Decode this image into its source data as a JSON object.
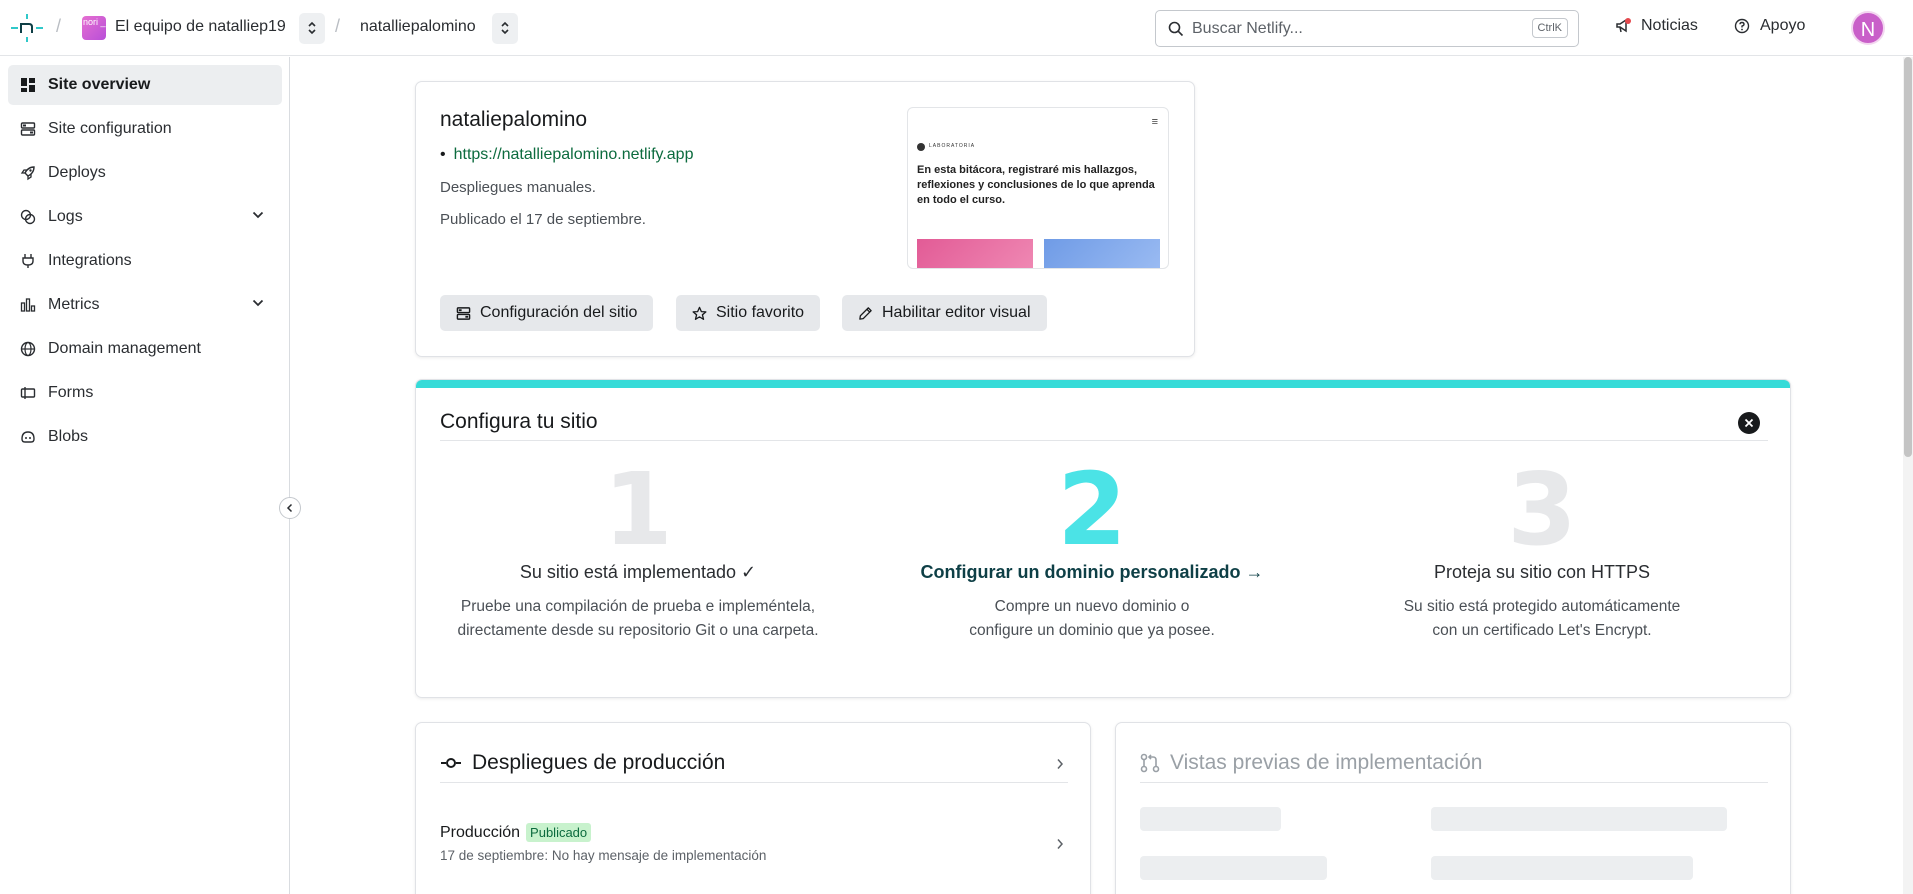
{
  "topbar": {
    "team_avatar_text": "nori\n_",
    "team_name": "El equipo de natalliep19",
    "site_name": "natalliepalomino",
    "search_placeholder": "Buscar Netlify...",
    "search_shortcut": "CtrlK",
    "news_label": "Noticias",
    "help_label": "Apoyo",
    "user_initial": "N"
  },
  "sidebar": {
    "items": [
      {
        "label": "Site overview",
        "icon": "grid-icon"
      },
      {
        "label": "Site configuration",
        "icon": "sliders-icon"
      },
      {
        "label": "Deploys",
        "icon": "rocket-icon"
      },
      {
        "label": "Logs",
        "icon": "logs-icon"
      },
      {
        "label": "Integrations",
        "icon": "plug-icon"
      },
      {
        "label": "Metrics",
        "icon": "bar-chart-icon"
      },
      {
        "label": "Domain management",
        "icon": "globe-icon"
      },
      {
        "label": "Forms",
        "icon": "form-icon"
      },
      {
        "label": "Blobs",
        "icon": "blob-icon"
      }
    ]
  },
  "site_card": {
    "title": "nataliepalomino",
    "url": "https://natalliepalomino.netlify.app",
    "deploy_type": "Despliegues manuales.",
    "published": "Publicado el 17 de septiembre.",
    "preview": {
      "brand": "LABORATORIA",
      "heading": "En esta bitácora, registraré mis hallazgos, reflexiones y conclusiones de lo que aprenda en todo el curso."
    },
    "buttons": {
      "config": "Configuración del sitio",
      "favorite": "Sitio favorito",
      "visual_editor": "Habilitar editor visual"
    }
  },
  "config_card": {
    "title": "Configura tu sitio",
    "steps": [
      {
        "number": "1",
        "title": "Su sitio está implementado ✓",
        "desc_1": "Pruebe una compilación de prueba e impleméntela,",
        "desc_2": "directamente desde su repositorio Git o una carpeta."
      },
      {
        "number": "2",
        "title": "Configurar un dominio personalizado →",
        "desc_1": "Compre un nuevo dominio o",
        "desc_2": "configure un dominio que ya posee."
      },
      {
        "number": "3",
        "title": "Proteja su sitio con HTTPS",
        "desc_1": "Su sitio está protegido automáticamente",
        "desc_2": "con un certificado Let's Encrypt."
      }
    ]
  },
  "deploys_card": {
    "title": "Despliegues de producción",
    "row_label": "Producción",
    "row_badge": "Publicado",
    "row_sub": "17 de septiembre: No hay mensaje de implementación"
  },
  "previews_card": {
    "title": "Vistas previas de implementación"
  },
  "colors": {
    "accent_teal": "#36dbd8",
    "step_active": "#4be3e6",
    "link_green": "#0c6b3e",
    "badge_bg": "#c8f2cd"
  }
}
